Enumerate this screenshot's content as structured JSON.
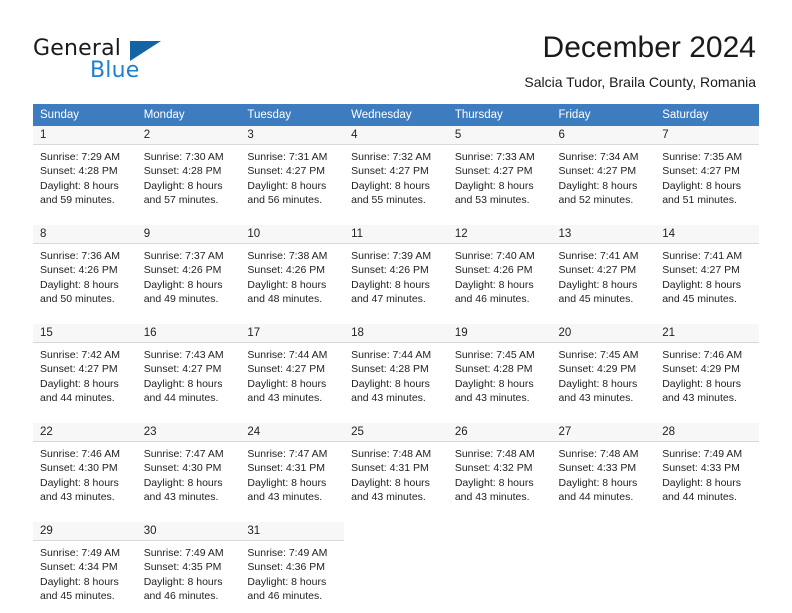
{
  "brand": {
    "word_general": "General",
    "word_blue": "Blue",
    "triangle_color": "#1464a5",
    "blue_color": "#1f7fd0"
  },
  "header": {
    "month_title": "December 2024",
    "location": "Salcia Tudor, Braila County, Romania",
    "header_bg": "#3d7dbf"
  },
  "calendar": {
    "weekday_headers": [
      "Sunday",
      "Monday",
      "Tuesday",
      "Wednesday",
      "Thursday",
      "Friday",
      "Saturday"
    ],
    "weeks": [
      [
        {
          "day": "1",
          "sunrise": "Sunrise: 7:29 AM",
          "sunset": "Sunset: 4:28 PM",
          "daylight1": "Daylight: 8 hours",
          "daylight2": "and 59 minutes."
        },
        {
          "day": "2",
          "sunrise": "Sunrise: 7:30 AM",
          "sunset": "Sunset: 4:28 PM",
          "daylight1": "Daylight: 8 hours",
          "daylight2": "and 57 minutes."
        },
        {
          "day": "3",
          "sunrise": "Sunrise: 7:31 AM",
          "sunset": "Sunset: 4:27 PM",
          "daylight1": "Daylight: 8 hours",
          "daylight2": "and 56 minutes."
        },
        {
          "day": "4",
          "sunrise": "Sunrise: 7:32 AM",
          "sunset": "Sunset: 4:27 PM",
          "daylight1": "Daylight: 8 hours",
          "daylight2": "and 55 minutes."
        },
        {
          "day": "5",
          "sunrise": "Sunrise: 7:33 AM",
          "sunset": "Sunset: 4:27 PM",
          "daylight1": "Daylight: 8 hours",
          "daylight2": "and 53 minutes."
        },
        {
          "day": "6",
          "sunrise": "Sunrise: 7:34 AM",
          "sunset": "Sunset: 4:27 PM",
          "daylight1": "Daylight: 8 hours",
          "daylight2": "and 52 minutes."
        },
        {
          "day": "7",
          "sunrise": "Sunrise: 7:35 AM",
          "sunset": "Sunset: 4:27 PM",
          "daylight1": "Daylight: 8 hours",
          "daylight2": "and 51 minutes."
        }
      ],
      [
        {
          "day": "8",
          "sunrise": "Sunrise: 7:36 AM",
          "sunset": "Sunset: 4:26 PM",
          "daylight1": "Daylight: 8 hours",
          "daylight2": "and 50 minutes."
        },
        {
          "day": "9",
          "sunrise": "Sunrise: 7:37 AM",
          "sunset": "Sunset: 4:26 PM",
          "daylight1": "Daylight: 8 hours",
          "daylight2": "and 49 minutes."
        },
        {
          "day": "10",
          "sunrise": "Sunrise: 7:38 AM",
          "sunset": "Sunset: 4:26 PM",
          "daylight1": "Daylight: 8 hours",
          "daylight2": "and 48 minutes."
        },
        {
          "day": "11",
          "sunrise": "Sunrise: 7:39 AM",
          "sunset": "Sunset: 4:26 PM",
          "daylight1": "Daylight: 8 hours",
          "daylight2": "and 47 minutes."
        },
        {
          "day": "12",
          "sunrise": "Sunrise: 7:40 AM",
          "sunset": "Sunset: 4:26 PM",
          "daylight1": "Daylight: 8 hours",
          "daylight2": "and 46 minutes."
        },
        {
          "day": "13",
          "sunrise": "Sunrise: 7:41 AM",
          "sunset": "Sunset: 4:27 PM",
          "daylight1": "Daylight: 8 hours",
          "daylight2": "and 45 minutes."
        },
        {
          "day": "14",
          "sunrise": "Sunrise: 7:41 AM",
          "sunset": "Sunset: 4:27 PM",
          "daylight1": "Daylight: 8 hours",
          "daylight2": "and 45 minutes."
        }
      ],
      [
        {
          "day": "15",
          "sunrise": "Sunrise: 7:42 AM",
          "sunset": "Sunset: 4:27 PM",
          "daylight1": "Daylight: 8 hours",
          "daylight2": "and 44 minutes."
        },
        {
          "day": "16",
          "sunrise": "Sunrise: 7:43 AM",
          "sunset": "Sunset: 4:27 PM",
          "daylight1": "Daylight: 8 hours",
          "daylight2": "and 44 minutes."
        },
        {
          "day": "17",
          "sunrise": "Sunrise: 7:44 AM",
          "sunset": "Sunset: 4:27 PM",
          "daylight1": "Daylight: 8 hours",
          "daylight2": "and 43 minutes."
        },
        {
          "day": "18",
          "sunrise": "Sunrise: 7:44 AM",
          "sunset": "Sunset: 4:28 PM",
          "daylight1": "Daylight: 8 hours",
          "daylight2": "and 43 minutes."
        },
        {
          "day": "19",
          "sunrise": "Sunrise: 7:45 AM",
          "sunset": "Sunset: 4:28 PM",
          "daylight1": "Daylight: 8 hours",
          "daylight2": "and 43 minutes."
        },
        {
          "day": "20",
          "sunrise": "Sunrise: 7:45 AM",
          "sunset": "Sunset: 4:29 PM",
          "daylight1": "Daylight: 8 hours",
          "daylight2": "and 43 minutes."
        },
        {
          "day": "21",
          "sunrise": "Sunrise: 7:46 AM",
          "sunset": "Sunset: 4:29 PM",
          "daylight1": "Daylight: 8 hours",
          "daylight2": "and 43 minutes."
        }
      ],
      [
        {
          "day": "22",
          "sunrise": "Sunrise: 7:46 AM",
          "sunset": "Sunset: 4:30 PM",
          "daylight1": "Daylight: 8 hours",
          "daylight2": "and 43 minutes."
        },
        {
          "day": "23",
          "sunrise": "Sunrise: 7:47 AM",
          "sunset": "Sunset: 4:30 PM",
          "daylight1": "Daylight: 8 hours",
          "daylight2": "and 43 minutes."
        },
        {
          "day": "24",
          "sunrise": "Sunrise: 7:47 AM",
          "sunset": "Sunset: 4:31 PM",
          "daylight1": "Daylight: 8 hours",
          "daylight2": "and 43 minutes."
        },
        {
          "day": "25",
          "sunrise": "Sunrise: 7:48 AM",
          "sunset": "Sunset: 4:31 PM",
          "daylight1": "Daylight: 8 hours",
          "daylight2": "and 43 minutes."
        },
        {
          "day": "26",
          "sunrise": "Sunrise: 7:48 AM",
          "sunset": "Sunset: 4:32 PM",
          "daylight1": "Daylight: 8 hours",
          "daylight2": "and 43 minutes."
        },
        {
          "day": "27",
          "sunrise": "Sunrise: 7:48 AM",
          "sunset": "Sunset: 4:33 PM",
          "daylight1": "Daylight: 8 hours",
          "daylight2": "and 44 minutes."
        },
        {
          "day": "28",
          "sunrise": "Sunrise: 7:49 AM",
          "sunset": "Sunset: 4:33 PM",
          "daylight1": "Daylight: 8 hours",
          "daylight2": "and 44 minutes."
        }
      ],
      [
        {
          "day": "29",
          "sunrise": "Sunrise: 7:49 AM",
          "sunset": "Sunset: 4:34 PM",
          "daylight1": "Daylight: 8 hours",
          "daylight2": "and 45 minutes."
        },
        {
          "day": "30",
          "sunrise": "Sunrise: 7:49 AM",
          "sunset": "Sunset: 4:35 PM",
          "daylight1": "Daylight: 8 hours",
          "daylight2": "and 46 minutes."
        },
        {
          "day": "31",
          "sunrise": "Sunrise: 7:49 AM",
          "sunset": "Sunset: 4:36 PM",
          "daylight1": "Daylight: 8 hours",
          "daylight2": "and 46 minutes."
        },
        {
          "day": "",
          "sunrise": "",
          "sunset": "",
          "daylight1": "",
          "daylight2": ""
        },
        {
          "day": "",
          "sunrise": "",
          "sunset": "",
          "daylight1": "",
          "daylight2": ""
        },
        {
          "day": "",
          "sunrise": "",
          "sunset": "",
          "daylight1": "",
          "daylight2": ""
        },
        {
          "day": "",
          "sunrise": "",
          "sunset": "",
          "daylight1": "",
          "daylight2": ""
        }
      ]
    ]
  }
}
